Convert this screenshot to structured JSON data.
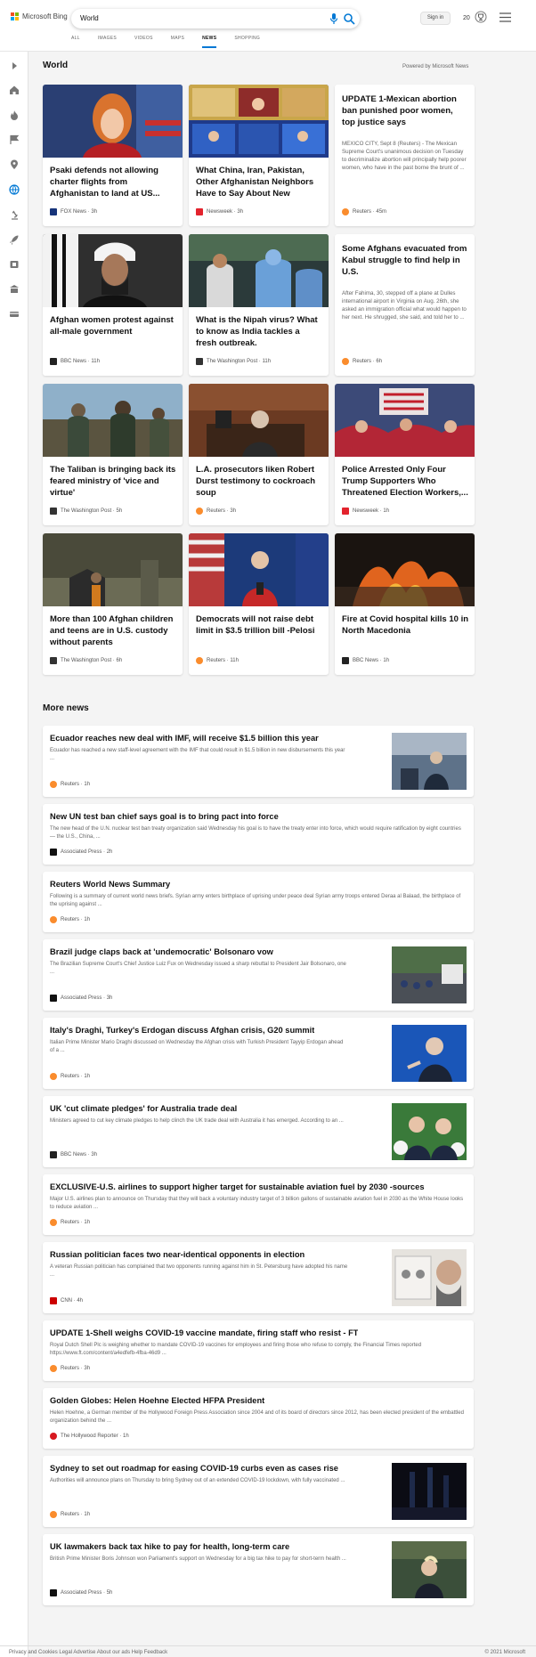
{
  "header": {
    "logo_text": "Microsoft Bing",
    "query": "World",
    "signin_label": "Sign in",
    "rewards_count": "20",
    "tabs": [
      {
        "label": "ALL",
        "active": false
      },
      {
        "label": "IMAGES",
        "active": false
      },
      {
        "label": "VIDEOS",
        "active": false
      },
      {
        "label": "MAPS",
        "active": false
      },
      {
        "label": "NEWS",
        "active": true
      },
      {
        "label": "SHOPPING",
        "active": false
      }
    ]
  },
  "section": {
    "title": "World",
    "powered": "Powered by Microsoft News"
  },
  "cards": [
    {
      "title": "Psaki defends not allowing charter flights from Afghanistan to land at US...",
      "source": "FOX News",
      "age": "3h",
      "type": "image",
      "icon": "fox-news-icon"
    },
    {
      "title": "What China, Iran, Pakistan, Other Afghanistan Neighbors Have to Say About New Taliba...",
      "source": "Newsweek",
      "age": "3h",
      "type": "image",
      "icon": "newsweek-icon"
    },
    {
      "title": "UPDATE 1-Mexican abortion ban punished poor women, top justice says",
      "snippet": "MEXICO CITY, Sept 8 (Reuters) - The Mexican Supreme Court's unanimous decision on Tuesday to decriminalize abortion will principally help poorer women, who have in the past borne the brunt of ...",
      "source": "Reuters",
      "age": "45m",
      "type": "text",
      "icon": "reuters-icon"
    },
    {
      "title": "Afghan women protest against all-male government",
      "source": "BBC News",
      "age": "11h",
      "type": "image",
      "icon": "bbc-icon"
    },
    {
      "title": "What is the Nipah virus? What to know as India tackles a fresh outbreak.",
      "source": "The Washington Post",
      "age": "11h",
      "type": "image",
      "icon": "washington-post-icon"
    },
    {
      "title": "Some Afghans evacuated from Kabul struggle to find help in U.S.",
      "snippet": "After Fahima, 30, stepped off a plane at Dulles international airport in Virginia on Aug. 26th, she asked an immigration official what would happen to her next. He shrugged, she said, and told her to ...",
      "source": "Reuters",
      "age": "6h",
      "type": "text",
      "icon": "reuters-icon"
    },
    {
      "title": "The Taliban is bringing back its feared ministry of 'vice and virtue'",
      "source": "The Washington Post",
      "age": "5h",
      "type": "image",
      "icon": "washington-post-icon"
    },
    {
      "title": "L.A. prosecutors liken Robert Durst testimony to cockroach soup",
      "source": "Reuters",
      "age": "3h",
      "type": "image",
      "icon": "reuters-icon"
    },
    {
      "title": "Police Arrested Only Four Trump Supporters Who Threatened Election Workers,...",
      "source": "Newsweek",
      "age": "1h",
      "type": "image",
      "icon": "newsweek-icon"
    },
    {
      "title": "More than 100 Afghan children and teens are in U.S. custody without parents",
      "source": "The Washington Post",
      "age": "6h",
      "type": "image",
      "icon": "washington-post-icon"
    },
    {
      "title": "Democrats will not raise debt limit in $3.5 trillion bill -Pelosi",
      "source": "Reuters",
      "age": "11h",
      "type": "image",
      "icon": "reuters-icon"
    },
    {
      "title": "Fire at Covid hospital kills 10 in North Macedonia",
      "source": "BBC News",
      "age": "1h",
      "type": "image",
      "icon": "bbc-icon"
    }
  ],
  "more_news": {
    "title": "More news",
    "items": [
      {
        "title": "Ecuador reaches new deal with IMF, will receive $1.5 billion this year",
        "snippet": "Ecuador has reached a new staff-level agreement with the IMF that could result in $1.5 billion in new disbursements this year ...",
        "source": "Reuters",
        "age": "1h",
        "has_image": true,
        "icon": "reuters-icon"
      },
      {
        "title": "New UN test ban chief says goal is to bring pact into force",
        "snippet": "The new head of the U.N. nuclear test ban treaty organization said Wednesday his goal is to have the treaty enter into force, which would require ratification by eight countries — the U.S., China, ...",
        "source": "Associated Press",
        "age": "2h",
        "has_image": false,
        "icon": "ap-icon"
      },
      {
        "title": "Reuters World News Summary",
        "snippet": "Following is a summary of current world news briefs. Syrian army enters birthplace of uprising under peace deal Syrian army troops entered Deraa al Balaad, the birthplace of the uprising against ...",
        "source": "Reuters",
        "age": "1h",
        "has_image": false,
        "icon": "reuters-icon"
      },
      {
        "title": "Brazil judge claps back at 'undemocratic' Bolsonaro vow",
        "snippet": "The Brazilian Supreme Court's Chief Justice Luiz Fux on Wednesday issued a sharp rebuttal to President Jair Bolsonaro, one ...",
        "source": "Associated Press",
        "age": "3h",
        "has_image": true,
        "icon": "ap-icon"
      },
      {
        "title": "Italy's Draghi, Turkey's Erdogan discuss Afghan crisis, G20 summit",
        "snippet": "Italian Prime Minister Mario Draghi discussed on Wednesday the Afghan crisis with Turkish President Tayyip Erdogan ahead of a ...",
        "source": "Reuters",
        "age": "1h",
        "has_image": true,
        "icon": "reuters-icon"
      },
      {
        "title": "UK 'cut climate pledges' for Australia trade deal",
        "snippet": "Ministers agreed to cut key climate pledges to help clinch the UK trade deal with Australia it has emerged. According to an ...",
        "source": "BBC News",
        "age": "3h",
        "has_image": true,
        "icon": "bbc-icon"
      },
      {
        "title": "EXCLUSIVE-U.S. airlines to support higher target for sustainable aviation fuel by 2030 -sources",
        "snippet": "Major U.S. airlines plan to announce on Thursday that they will back a voluntary industry target of 3 billion gallons of sustainable aviation fuel in 2030 as the White House looks to reduce aviation ...",
        "source": "Reuters",
        "age": "1h",
        "has_image": false,
        "icon": "reuters-icon"
      },
      {
        "title": "Russian politician faces two near-identical opponents in election",
        "snippet": "A veteran Russian politician has complained that two opponents running against him in St. Petersburg have adopted his name ...",
        "source": "CNN",
        "age": "4h",
        "has_image": true,
        "icon": "cnn-icon"
      },
      {
        "title": "UPDATE 1-Shell weighs COVID-19 vaccine mandate, firing staff who resist - FT",
        "snippet": "Royal Dutch Shell Plc is weighing whether to mandate COVID-19 vaccines for employees and firing those who refuse to comply, the Financial Times reported https://www.ft.com/content/a4edfefb-4fba-46d9 ...",
        "source": "Reuters",
        "age": "3h",
        "has_image": false,
        "icon": "reuters-icon"
      },
      {
        "title": "Golden Globes: Helen Hoehne Elected HFPA President",
        "snippet": "Helen Hoehne, a German member of the Hollywood Foreign Press Association since 2004 and of its board of directors since 2012, has been elected president of the embattled organization behind the ...",
        "source": "The Hollywood Reporter",
        "age": "1h",
        "has_image": false,
        "icon": "hollywood-reporter-icon"
      },
      {
        "title": "Sydney to set out roadmap for easing COVID-19 curbs even as cases rise",
        "snippet": "Authorities will announce plans on Thursday to bring Sydney out of an extended COVID-19 lockdown, with fully vaccinated ...",
        "source": "Reuters",
        "age": "1h",
        "has_image": true,
        "icon": "reuters-icon"
      },
      {
        "title": "UK lawmakers back tax hike to pay for health, long-term care",
        "snippet": "British Prime Minister Boris Johnson won Parliament's support on Wednesday for a big tax hike to pay for short-term health ...",
        "source": "Associated Press",
        "age": "5h",
        "has_image": true,
        "icon": "ap-icon"
      }
    ]
  },
  "footer": {
    "left": "Privacy and Cookies   Legal   Advertise   About our ads   Help   Feedback",
    "right": "© 2021 Microsoft"
  },
  "colors": {
    "accent": "#0078d4",
    "reuters": "#fa8c2d",
    "newsweek": "#e3232d",
    "bbc": "#222222",
    "fox": "#16347a"
  }
}
